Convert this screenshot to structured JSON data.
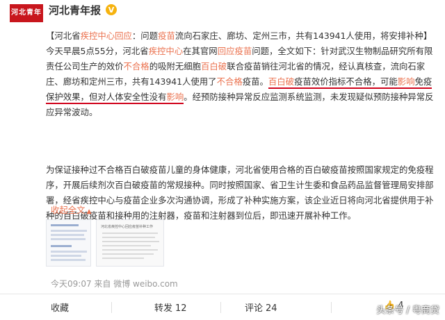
{
  "account": {
    "avatar_text": "河北青年报",
    "name": "河北青年报"
  },
  "post": {
    "p1": {
      "t01": "【河北省",
      "h01": "疾控中心回应",
      "t02": "：问题",
      "h02": "疫苗",
      "t03": "流向石家庄、廊坊、定州三市，共有143941人使用，将安排补种】今天早晨5点55分，河北省",
      "h03": "疾控中心",
      "t04": "在其官网",
      "h04": "回应疫苗",
      "t05": "问题，全文如下：针对武汉生物制品研究所有限责任公司生产的效价",
      "h05": "不合格",
      "t06": "的吸附无细胞",
      "h06": "百白破",
      "t07": "联合疫苗销往河北省的情况，经认真核查，流向石家庄、廊坊和定州三市，共有143941人使用了",
      "h07": "不合格",
      "t08": "疫苗。",
      "h08": "百白破",
      "t09": "疫苗效价指标不合格，可能",
      "h09": "影响",
      "t10": "免疫保护效果，但对人体安全性没有",
      "h10": "影响",
      "t11": "。经预防接种异常反应监测系统监测，未发现疑似预防接种异常反应异常波动。"
    },
    "p2": "为保证接种过不合格百白破疫苗儿童的身体健康，河北省使用合格的百白破疫苗按照国家规定的免疫程序，开展后续剂次百白破疫苗的常规接种。同时按照国家、省卫生计生委和食品药品监督管理局安排部署，经省疾控中心与疫苗企业多次沟通协调，形成了补种实施方案，该企业近日将向河北省提供用于补种的百白破疫苗和接种用的注射器，疫苗和注射器到位后，即迅速开展补种工作。",
    "expand_label": "收起全文",
    "doc_title": "河北省疾控中心回应疫苗补种工作",
    "meta": "今天09:07 来自 微博 weibo.com"
  },
  "footer": {
    "collect_label": "收藏",
    "repost_label": "转发",
    "repost_count": "12",
    "comment_label": "评论",
    "comment_count": "24",
    "like_count": "4"
  },
  "watermark": "头条号 / 粤商贷",
  "colors": {
    "link_orange": "#eb7350",
    "underline_red": "#d0021b",
    "verify_yellow": "#f6b30f",
    "avatar_red": "#c8161d"
  },
  "icons": [
    "verify-icon",
    "chevron-up-icon",
    "thumb-up-icon"
  ]
}
